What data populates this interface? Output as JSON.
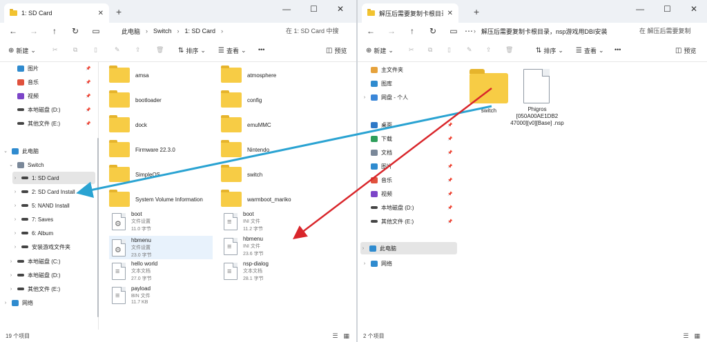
{
  "left_window": {
    "tab_title": "1: SD Card",
    "breadcrumbs": [
      "此电脑",
      "Switch",
      "1: SD Card"
    ],
    "search_placeholder": "在 1: SD Card 中搜",
    "commands": {
      "new": "新建",
      "sort": "排序",
      "view": "查看",
      "more": "•••",
      "preview": "预览"
    },
    "nav": [
      {
        "label": "图片",
        "icon": "picture-icon",
        "chev": "",
        "pinned": true
      },
      {
        "label": "音乐",
        "icon": "music-icon",
        "chev": "",
        "pinned": true
      },
      {
        "label": "视频",
        "icon": "video-icon",
        "chev": "",
        "pinned": true
      },
      {
        "label": "本地磁盘 (D:)",
        "icon": "drive-icon",
        "chev": "",
        "pinned": true
      },
      {
        "label": "其他文件 (E:)",
        "icon": "drive-icon",
        "chev": "",
        "pinned": true
      },
      {
        "label": "此电脑",
        "icon": "pc-icon",
        "chev": "⌄",
        "pinned": false
      },
      {
        "label": "Switch",
        "icon": "device-icon",
        "chev": "⌄",
        "pinned": false
      },
      {
        "label": "1: SD Card",
        "icon": "drive-icon",
        "chev": "›",
        "pinned": false
      },
      {
        "label": "2: SD Card Install",
        "icon": "drive-icon",
        "chev": "›",
        "pinned": false
      },
      {
        "label": "5: NAND Install",
        "icon": "drive-icon",
        "chev": "›",
        "pinned": false
      },
      {
        "label": "7: Saves",
        "icon": "drive-icon",
        "chev": "›",
        "pinned": false
      },
      {
        "label": "6: Album",
        "icon": "drive-icon",
        "chev": "›",
        "pinned": false
      },
      {
        "label": "安装游戏文件夹",
        "icon": "drive-icon",
        "chev": "›",
        "pinned": false
      },
      {
        "label": "本地磁盘 (C:)",
        "icon": "drive-icon",
        "chev": "›",
        "pinned": false
      },
      {
        "label": "本地磁盘 (D:)",
        "icon": "drive-icon",
        "chev": "›",
        "pinned": false
      },
      {
        "label": "其他文件 (E:)",
        "icon": "drive-icon",
        "chev": "›",
        "pinned": false
      },
      {
        "label": "网络",
        "icon": "network-icon",
        "chev": "›",
        "pinned": false
      }
    ],
    "folders": [
      "amsa",
      "atmosphere",
      "bootloader",
      "config",
      "dock",
      "emuMMC",
      "Firmware 22.3.0",
      "Nintendo",
      "SimpleOS",
      "switch",
      "System Volume Information",
      "warmboot_mariko"
    ],
    "files": [
      {
        "name": "boot",
        "sub1": "文件设置",
        "sub2": "11.0 字节",
        "icon": "settings-file-icon"
      },
      {
        "name": "boot",
        "sub1": "INI 文件",
        "sub2": "11.2 字节",
        "icon": "text-file-icon"
      },
      {
        "name": "hbmenu",
        "sub1": "文件设置",
        "sub2": "23.0 字节",
        "icon": "settings-file-icon"
      },
      {
        "name": "hbmenu",
        "sub1": "INI 文件",
        "sub2": "23.6 字节",
        "icon": "text-file-icon"
      },
      {
        "name": "hello world",
        "sub1": "文本文档",
        "sub2": "27.0 字节",
        "icon": "text-file-icon"
      },
      {
        "name": "nsp-dialog",
        "sub1": "文本文档",
        "sub2": "28.1 字节",
        "icon": "text-file-icon"
      },
      {
        "name": "payload",
        "sub1": "BIN 文件",
        "sub2": "11.7 KB",
        "icon": "text-file-icon"
      }
    ],
    "status": "19 个项目"
  },
  "right_window": {
    "tab_title": "解压后需要复制卡根目录。nsp",
    "breadcrumbs": [
      "解压后需要复制卡根目录，nsp游戏用DBI安装"
    ],
    "search_placeholder": "在 解压后需要复制",
    "commands": {
      "new": "新建",
      "sort": "排序",
      "view": "查看",
      "more": "•••",
      "preview": "预览"
    },
    "nav": [
      {
        "label": "主文件夹",
        "icon": "home-icon",
        "chev": "",
        "pinned": false
      },
      {
        "label": "图库",
        "icon": "gallery-icon",
        "chev": "",
        "pinned": false
      },
      {
        "label": "网盘 - 个人",
        "icon": "cloud-icon",
        "chev": "›",
        "pinned": false
      },
      {
        "label": "桌面",
        "icon": "desktop-icon",
        "chev": "",
        "pinned": true
      },
      {
        "label": "下载",
        "icon": "download-icon",
        "chev": "",
        "pinned": true
      },
      {
        "label": "文档",
        "icon": "document-icon",
        "chev": "",
        "pinned": true
      },
      {
        "label": "图片",
        "icon": "picture-icon",
        "chev": "",
        "pinned": true
      },
      {
        "label": "音乐",
        "icon": "music-icon",
        "chev": "",
        "pinned": true
      },
      {
        "label": "视频",
        "icon": "video-icon",
        "chev": "",
        "pinned": true
      },
      {
        "label": "本地磁盘 (D:)",
        "icon": "drive-icon",
        "chev": "",
        "pinned": true
      },
      {
        "label": "其他文件 (E:)",
        "icon": "drive-icon",
        "chev": "",
        "pinned": true
      },
      {
        "label": "此电脑",
        "icon": "pc-icon",
        "chev": "›",
        "pinned": false
      },
      {
        "label": "网络",
        "icon": "network-icon",
        "chev": "›",
        "pinned": false
      }
    ],
    "items": [
      {
        "name": "switch",
        "type": "folder"
      },
      {
        "name": "Phigros [050A00AE1DB2 47000][v0][Base] .nsp",
        "type": "file"
      }
    ],
    "status": "2 个项目"
  },
  "colors": {
    "arrow_blue": "#2aa3d2",
    "arrow_red": "#d9262b",
    "folder": "#f7cc45"
  }
}
